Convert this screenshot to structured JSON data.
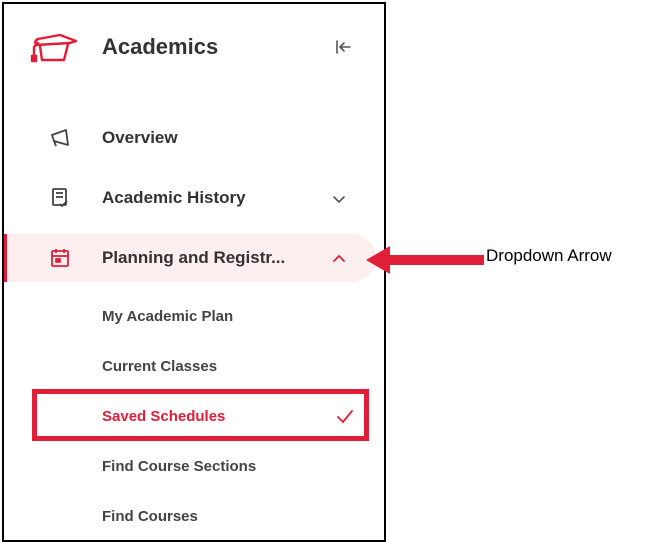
{
  "app": {
    "title": "Academics"
  },
  "nav": {
    "items": [
      {
        "label": "Overview",
        "icon": "megaphone-icon"
      },
      {
        "label": "Academic History",
        "icon": "document-check-icon",
        "chevron": "chevron-down-icon"
      },
      {
        "label": "Planning and Registr...",
        "icon": "calendar-icon",
        "chevron": "chevron-up-icon",
        "active": true
      }
    ],
    "sub_items": [
      {
        "label": "My Academic Plan"
      },
      {
        "label": "Current Classes"
      },
      {
        "label": "Saved Schedules",
        "selected": true
      },
      {
        "label": "Find Course Sections"
      },
      {
        "label": "Find Courses"
      }
    ]
  },
  "annotation": {
    "label": "Dropdown Arrow"
  },
  "colors": {
    "accent": "#e01e37",
    "active_bg": "#fdeef0",
    "text": "#333333"
  }
}
